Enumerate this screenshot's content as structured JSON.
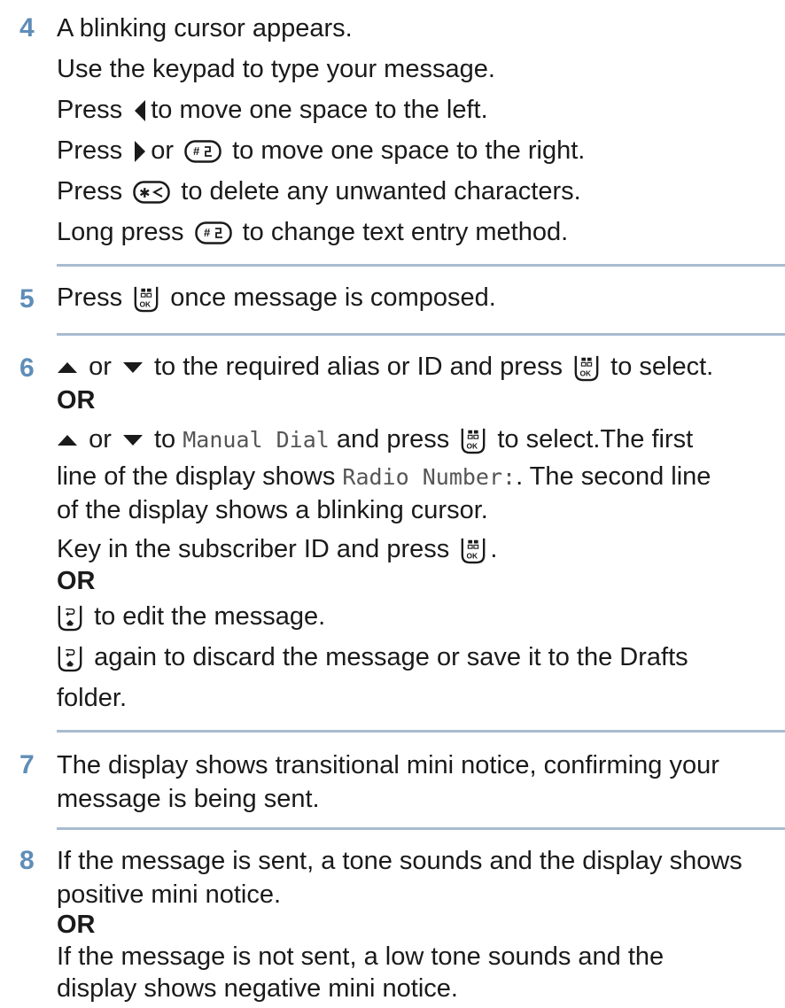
{
  "steps": [
    {
      "number": "4",
      "lines": {
        "l1": "A blinking cursor appears.",
        "l2": "Use the keypad to type your message.",
        "l3a": "Press",
        "l3b": "to move one space to the left.",
        "l4a": "Press",
        "l4b": "or",
        "l4c": "to move one space to the right.",
        "l5a": "Press",
        "l5b": "to delete any unwanted characters.",
        "l6a": "Long press",
        "l6b": "to change text entry method."
      }
    },
    {
      "number": "5",
      "lines": {
        "l1a": "Press",
        "l1b": "once message is composed."
      }
    },
    {
      "number": "6",
      "lines": {
        "l1a": "or",
        "l1b": "to the required alias or ID and press",
        "l1c": "to select.",
        "or1": "OR",
        "l2a": "or",
        "l2b": "to",
        "l2mono": "Manual Dial",
        "l2c": "and press",
        "l2d": "to select.The first",
        "l3a": "line of the display shows",
        "l3mono": "Radio Number:",
        "l3b": ". The second line",
        "l4": "of the display shows a blinking cursor.",
        "l5a": "Key in the subscriber ID and press",
        "l5b": ".",
        "or2": "OR",
        "l6": "to edit the message.",
        "l7": "again to discard the message or save it to the Drafts",
        "l8": "folder."
      }
    },
    {
      "number": "7",
      "lines": {
        "l1": "The display shows transitional mini notice, confirming your",
        "l2": "message is being sent."
      }
    },
    {
      "number": "8",
      "lines": {
        "l1": "If the message is sent, a tone sounds and the display shows",
        "l2": "positive mini notice.",
        "or": "OR",
        "l3": "If the message is not sent, a low tone sounds and the",
        "l4": "display shows negative mini notice."
      }
    }
  ],
  "keys": {
    "hash": "# ⌐",
    "star": "★ ≺",
    "ok": "OK"
  },
  "icons": [
    "left-arrow-icon",
    "right-arrow-icon",
    "hash-key-icon",
    "star-key-icon",
    "ok-key-icon",
    "up-arrow-icon",
    "down-arrow-icon",
    "back-home-key-icon"
  ]
}
